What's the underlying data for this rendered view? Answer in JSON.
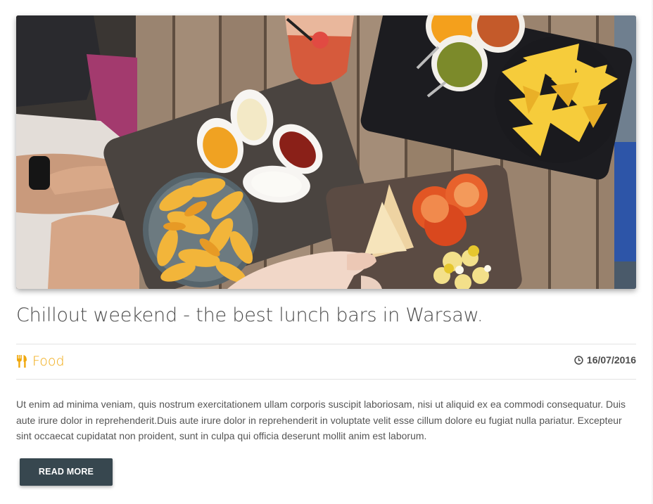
{
  "post": {
    "image_alt": "Table with fries, dips, nachos, toast and tomatoes",
    "title": "Chillout weekend - the best lunch bars in Warsaw.",
    "category": "Food",
    "date": "16/07/2016",
    "excerpt": "Ut enim ad minima veniam, quis nostrum exercitationem ullam corporis suscipit laboriosam, nisi ut aliquid ex ea commodi consequatur. Duis aute irure dolor in reprehenderit.Duis aute irure dolor in reprehenderit in voluptate velit esse cillum dolore eu fugiat nulla pariatur. Excepteur sint occaecat cupidatat non proident, sunt in culpa qui officia deserunt mollit anim est laborum.",
    "read_more_label": "READ MORE"
  },
  "icons": {
    "category": "cutlery-icon",
    "date": "clock-icon"
  },
  "colors": {
    "accent": "#f0a80e",
    "button": "#37474f",
    "title": "#4a4a4a",
    "text": "#555555"
  }
}
